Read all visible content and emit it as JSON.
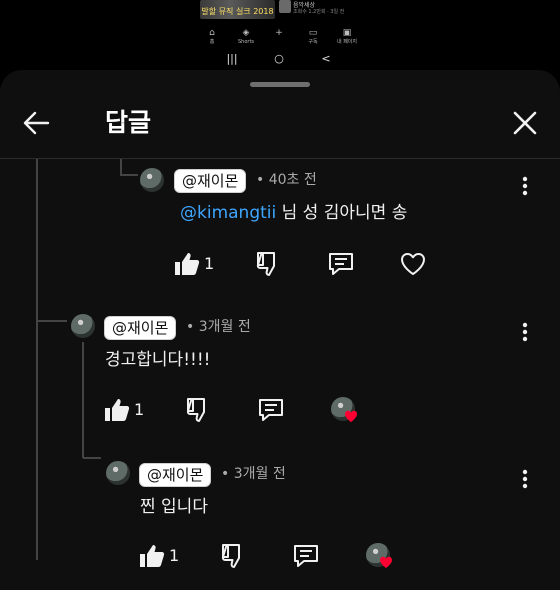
{
  "background": {
    "video_caption": "발할 뮤직 실크 2018",
    "channel_name": "음악세상",
    "channel_meta": "조회수 1.2만회 · 3일 전",
    "nav_tabs": [
      {
        "icon": "home-icon",
        "glyph": "⌂",
        "label": "홈"
      },
      {
        "icon": "shorts-icon",
        "glyph": "◈",
        "label": "Shorts"
      },
      {
        "icon": "create-icon",
        "glyph": "+",
        "label": ""
      },
      {
        "icon": "subscriptions-icon",
        "glyph": "▭",
        "label": "구독"
      },
      {
        "icon": "library-icon",
        "glyph": "▣",
        "label": "내 페이지"
      }
    ],
    "system_nav": [
      "|||",
      "○",
      "<"
    ]
  },
  "sheet": {
    "title": "답글",
    "back_icon": "arrow-left-icon",
    "close_icon": "close-icon"
  },
  "comments": [
    {
      "handle": "@재이몬",
      "time": "• 40초 전",
      "mention": "@kimangtii",
      "text": " 님 성 김아니면 송",
      "likes": "1",
      "has_heart_button": true
    },
    {
      "handle": "@재이몬",
      "time": "• 3개월 전",
      "mention": "",
      "text": "경고합니다!!!!",
      "likes": "1",
      "creator_hearted": true
    },
    {
      "handle": "@재이몬",
      "time": "• 3개월 전",
      "mention": "",
      "text": "찐 입니다",
      "likes": "1",
      "creator_hearted": true
    }
  ],
  "colors": {
    "sheet_bg": "#0f0f0f",
    "mention": "#3ea6ff",
    "heart": "#ff0033",
    "secondary_text": "#aaaaaa"
  }
}
